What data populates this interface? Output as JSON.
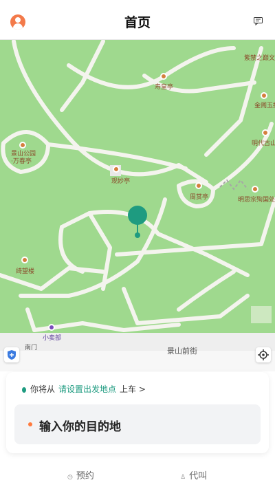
{
  "header": {
    "title": "首页"
  },
  "map": {
    "pois": [
      {
        "key": "shouhuangting",
        "label": "寿皇亭"
      },
      {
        "key": "jingshan",
        "label": "景山公园\n·万春亭"
      },
      {
        "key": "guanmiao",
        "label": "观妙亭"
      },
      {
        "key": "zhoushang",
        "label": "周赏亭"
      },
      {
        "key": "qiwanglou",
        "label": "绮望楼"
      },
      {
        "key": "ziji",
        "label": "紫禁之巅文化"
      },
      {
        "key": "jingelou",
        "label": "金阁玉捐"
      },
      {
        "key": "mingdai",
        "label": "明代古山"
      },
      {
        "key": "mingsi",
        "label": "明思宗殉国处"
      },
      {
        "key": "xiaomaibu",
        "label": "小卖部"
      },
      {
        "key": "nanmen",
        "label": "南门"
      }
    ],
    "street": "景山前街"
  },
  "pickup": {
    "prefix": "你将从",
    "link": "请设置出发地点",
    "suffix": "上车 >"
  },
  "destination": {
    "placeholder": "输入你的目的地"
  },
  "tabs": [
    {
      "label": "预约"
    },
    {
      "label": "代叫"
    }
  ],
  "colors": {
    "accent": "#1e9b80",
    "map_green": "#9fd98e",
    "poi_orange": "#d47f3d",
    "avatar_orange": "#f37a4a"
  }
}
